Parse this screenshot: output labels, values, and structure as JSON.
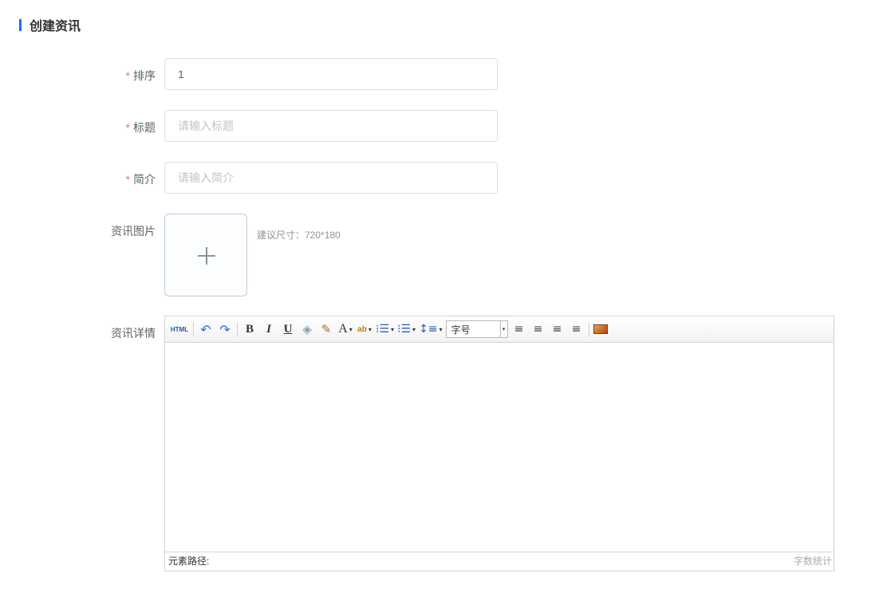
{
  "page": {
    "title": "创建资讯"
  },
  "form": {
    "sort": {
      "label": "排序",
      "required": "*",
      "value": "1"
    },
    "title": {
      "label": "标题",
      "required": "*",
      "placeholder": "请输入标题"
    },
    "summary": {
      "label": "简介",
      "required": "*",
      "placeholder": "请输入简介"
    },
    "image": {
      "label": "资讯图片",
      "hint": "建议尺寸：720*180"
    },
    "detail": {
      "label": "资讯详情"
    }
  },
  "editor": {
    "toolbar": {
      "html": "HTML",
      "undo": "↶",
      "redo": "↷",
      "bold": "B",
      "italic": "I",
      "underline": "U",
      "eraser": "◈",
      "brush": "✎",
      "font_color": "A",
      "bg_color": "ab",
      "ordered_list": "⁝☰",
      "unordered_list": "⁝☰",
      "line_height": "↕≡",
      "font_size": "字号",
      "align_left": "≡",
      "align_right": "≡",
      "align_center": "≡",
      "align_justify": "≡",
      "caret": "▾"
    },
    "status": {
      "element_path": "元素路径:",
      "word_count": "字数统计"
    },
    "icons": [
      "html-icon",
      "undo-icon",
      "redo-icon",
      "bold-icon",
      "italic-icon",
      "underline-icon",
      "eraser-icon",
      "format-brush-icon",
      "font-color-icon",
      "background-color-icon",
      "ordered-list-icon",
      "unordered-list-icon",
      "line-height-icon",
      "align-left-icon",
      "align-right-icon",
      "align-center-icon",
      "align-justify-icon",
      "image-icon"
    ]
  },
  "colors": {
    "accent": "#1f6fe5",
    "required": "#f56c6c",
    "border": "#dcdfe6"
  }
}
